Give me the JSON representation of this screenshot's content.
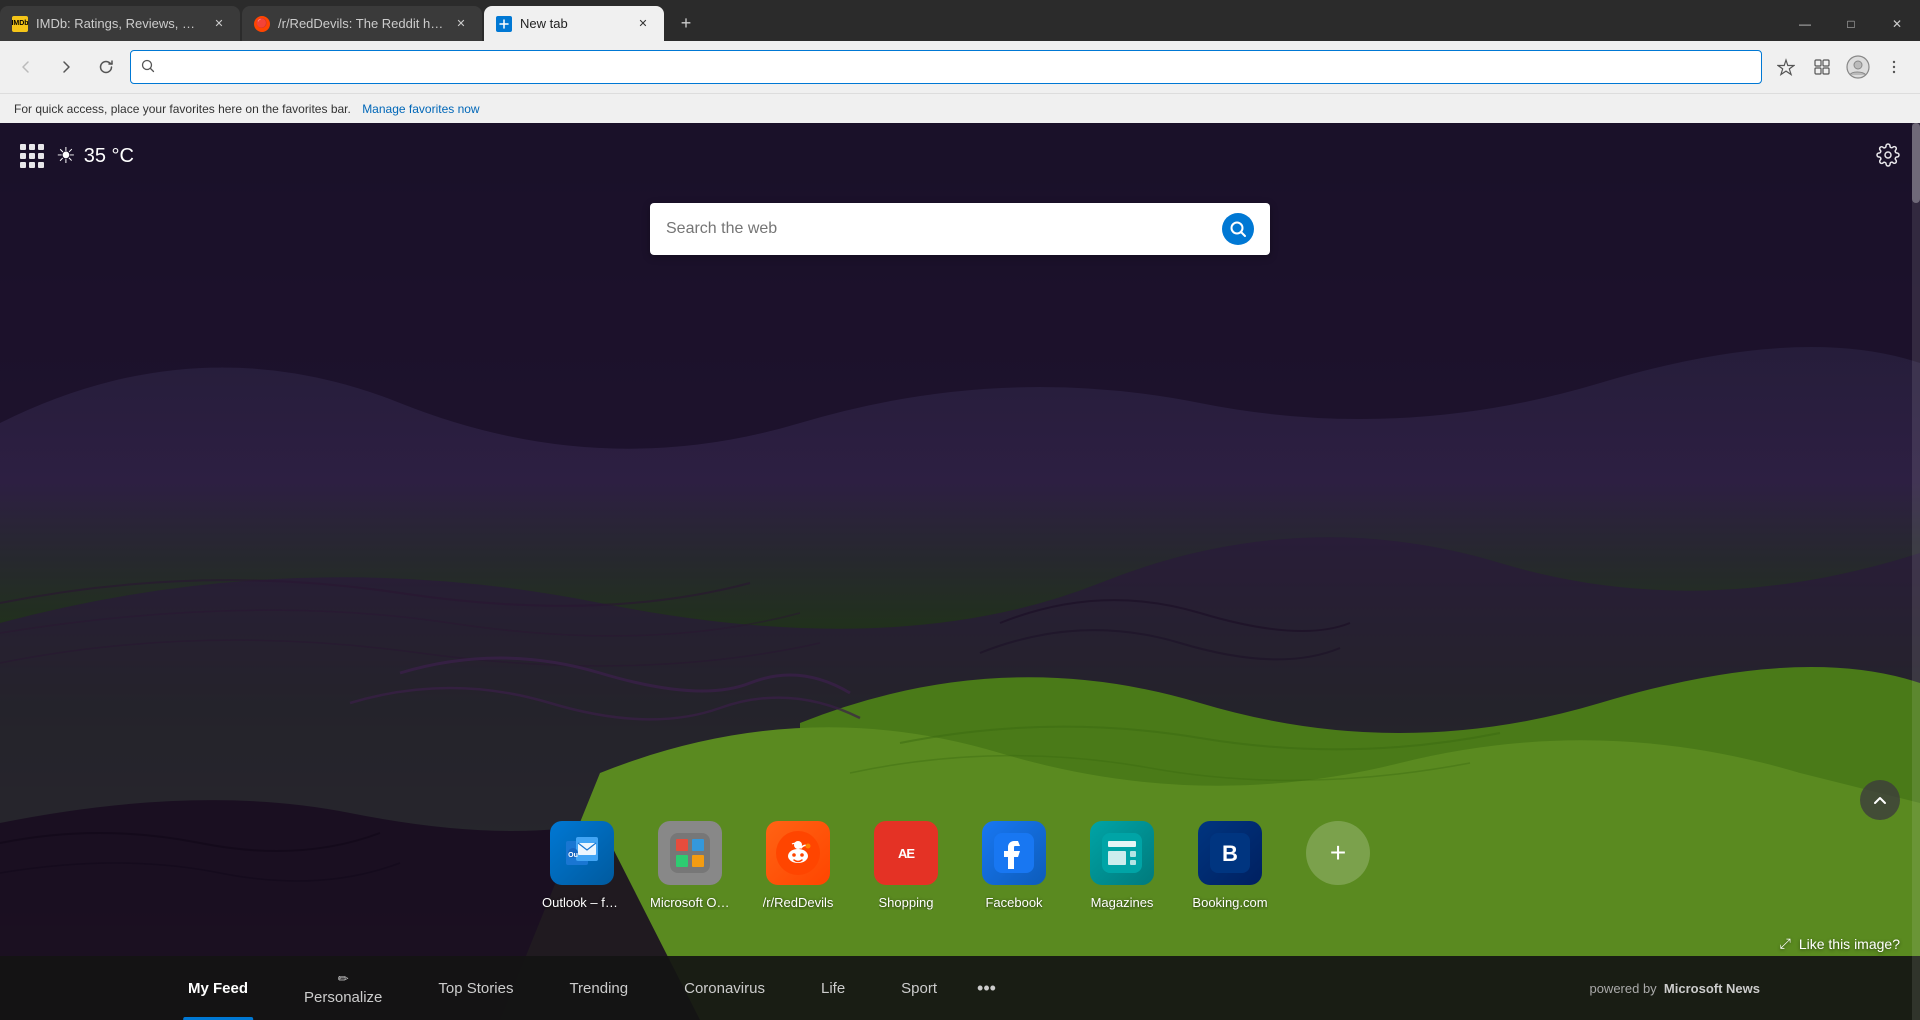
{
  "tabs": [
    {
      "id": "imdb",
      "title": "IMDb: Ratings, Reviews, and Wh...",
      "favicon_type": "imdb",
      "favicon_label": "IMDb",
      "active": false,
      "closable": true
    },
    {
      "id": "reddit",
      "title": "/r/RedDevils: The Reddit home f...",
      "favicon_type": "reddit",
      "favicon_label": "r",
      "active": false,
      "closable": true
    },
    {
      "id": "newtab",
      "title": "New tab",
      "favicon_type": "edge",
      "favicon_label": "⊞",
      "active": true,
      "closable": true
    }
  ],
  "window_controls": {
    "minimize": "—",
    "maximize": "□",
    "close": "✕"
  },
  "nav": {
    "back_disabled": true,
    "forward_disabled": false,
    "reload": "↺"
  },
  "address_bar": {
    "placeholder": "",
    "value": ""
  },
  "favorites_bar": {
    "hint": "For quick access, place your favorites here on the favorites bar.",
    "manage_link": "Manage favorites now"
  },
  "weather": {
    "temp": "35 °C",
    "icon": "☀"
  },
  "search": {
    "placeholder": "Search the web",
    "value": ""
  },
  "quick_links": [
    {
      "id": "outlook",
      "label": "Outlook – fre...",
      "style_class": "ql-outlook",
      "icon": "📧"
    },
    {
      "id": "office",
      "label": "Microsoft Offi...",
      "style_class": "ql-office",
      "icon": "⬜"
    },
    {
      "id": "reddevils",
      "label": "/r/RedDevils",
      "style_class": "ql-reddit",
      "icon": "👾"
    },
    {
      "id": "shopping",
      "label": "Shopping",
      "style_class": "ql-aliexpress",
      "icon": "AE"
    },
    {
      "id": "facebook",
      "label": "Facebook",
      "style_class": "ql-facebook",
      "icon": "f"
    },
    {
      "id": "magazines",
      "label": "Magazines",
      "style_class": "ql-magazines",
      "icon": "📰"
    },
    {
      "id": "booking",
      "label": "Booking.com",
      "style_class": "ql-booking",
      "icon": "B"
    }
  ],
  "add_link_label": "+",
  "like_image": {
    "label": "Like this image?",
    "icon": "⤢"
  },
  "bottom_nav": {
    "items": [
      {
        "id": "myfeed",
        "label": "My Feed",
        "icon": "",
        "active": true
      },
      {
        "id": "personalize",
        "label": "Personalize",
        "icon": "✏",
        "active": false
      },
      {
        "id": "topstories",
        "label": "Top Stories",
        "icon": "",
        "active": false
      },
      {
        "id": "trending",
        "label": "Trending",
        "icon": "",
        "active": false
      },
      {
        "id": "coronavirus",
        "label": "Coronavirus",
        "icon": "",
        "active": false
      },
      {
        "id": "life",
        "label": "Life",
        "icon": "",
        "active": false
      },
      {
        "id": "sport",
        "label": "Sport",
        "icon": "",
        "active": false
      }
    ],
    "more_icon": "•••",
    "powered_by": "powered by",
    "powered_by_brand": "Microsoft News"
  }
}
